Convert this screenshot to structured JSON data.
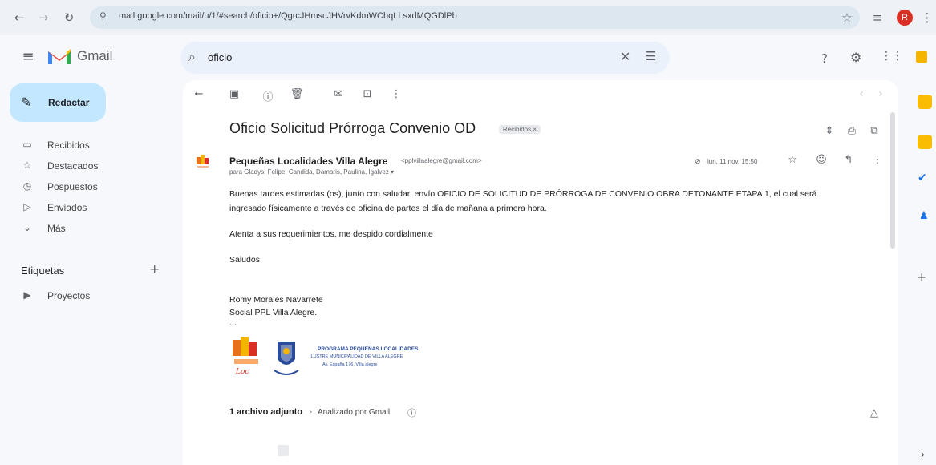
{
  "browser": {
    "url": "mail.google.com/mail/u/1/#search/oficio+/QgrcJHmscJHVrvKdmWChqLLsxdMQGDlPb",
    "profile_initial": "R",
    "colors": {
      "profile": "#d93025"
    }
  },
  "header": {
    "logo_text": "Gmail",
    "search_value": "oficio"
  },
  "sidebar": {
    "compose_label": "Redactar",
    "items": [
      {
        "icon": "inbox-icon",
        "label": "Recibidos"
      },
      {
        "icon": "star-icon",
        "label": "Destacados"
      },
      {
        "icon": "clock-icon",
        "label": "Pospuestos"
      },
      {
        "icon": "send-icon",
        "label": "Enviados"
      },
      {
        "icon": "chevron-down-icon",
        "label": "Más"
      }
    ],
    "labels_heading": "Etiquetas",
    "labels": [
      {
        "icon": "label-icon",
        "label": "Proyectos"
      }
    ]
  },
  "email": {
    "subject": "Oficio Solicitud Prórroga Convenio OD",
    "badge": "Recibidos ×",
    "sender_name": "Pequeñas Localidades Villa Alegre",
    "sender_email": "<pplvillaalegre@gmail.com>",
    "recipients": "para Gladys, Felipe, Candida, Damaris, Paulina, Igalvez ▾",
    "date": "lun, 11 nov, 15:50",
    "body": [
      "Buenas tardes estimadas (os), junto con saludar, envío OFICIO DE SOLICITUD DE PRÓRROGA DE CONVENIO OBRA DETONANTE ETAPA 1, el cual será",
      "ingresado físicamente a través de oficina de partes el día de mañana a primera hora.",
      "Atenta a sus requerimientos, me despido cordialmente",
      "Saludos",
      "Romy Morales Navarrete",
      "Social PPL Villa Alegre.",
      "..."
    ],
    "signature_logo": {
      "line1": "PROGRAMA PEQUEÑAS LOCALIDADES",
      "line2": "ILUSTRE MUNICIPALIDAD DE VILLA ALEGRE",
      "line3": "Av. España 176, Villa alegre"
    },
    "attachment_count": "1 archivo adjunto",
    "scanned_text": "Analizado por Gmail"
  }
}
